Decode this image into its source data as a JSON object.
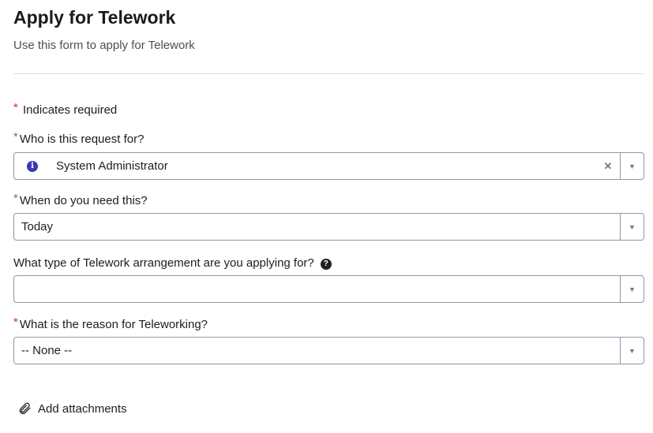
{
  "header": {
    "title": "Apply for Telework",
    "subtitle": "Use this form to apply for Telework"
  },
  "required_note": {
    "star": "*",
    "text": "Indicates required"
  },
  "fields": [
    {
      "label": "Who is this request for?",
      "required": true,
      "value": "System Administrator",
      "icon": "info-icon",
      "clearable": true
    },
    {
      "label": "When do you need this?",
      "required": true,
      "value": "Today"
    },
    {
      "label": "What type of Telework arrangement are you applying for?",
      "required": false,
      "value": "",
      "help_icon": "question-circle-icon"
    },
    {
      "label": "What is the reason for Teleworking?",
      "required": true,
      "value": "-- None --"
    }
  ],
  "attachments": {
    "label": "Add attachments",
    "icon": "paperclip-icon"
  },
  "colors": {
    "required_empty": "#e0242c",
    "required_filled": "#6b7583",
    "border": "#8d97a5"
  }
}
